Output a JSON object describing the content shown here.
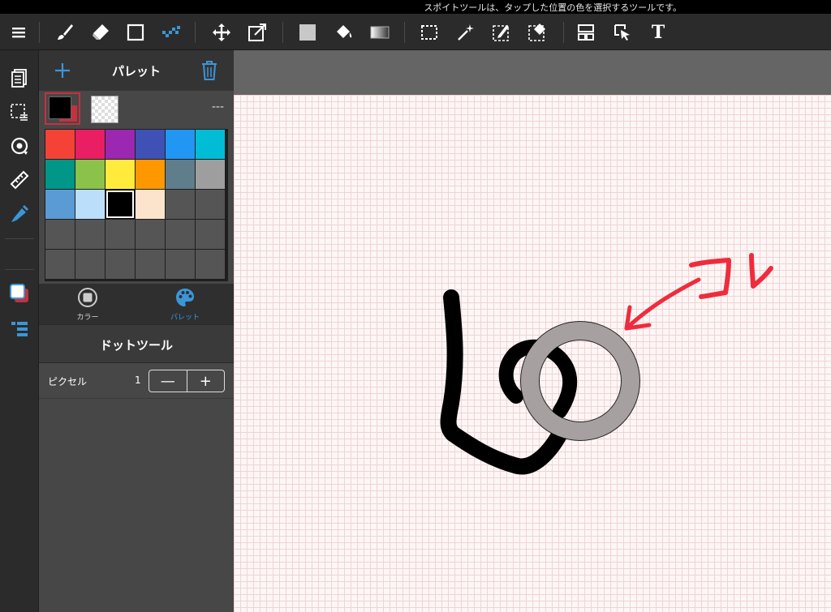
{
  "status": {
    "tooltip": "スポイトツールは、タップした位置の色を選択するツールです。"
  },
  "toolbar": {
    "tools": [
      "menu-icon",
      "brush-icon",
      "eraser-icon",
      "rectangle-icon",
      "dot-tool-icon",
      "move-icon",
      "transform-icon",
      "fill-color-icon",
      "bucket-icon",
      "gradient-icon",
      "select-rect-icon",
      "magic-wand-icon",
      "select-pen-icon",
      "select-eraser-icon",
      "layout-icon",
      "operation-icon",
      "text-icon"
    ],
    "text_tool_label": "T"
  },
  "rail": {
    "items": [
      "layers-icon",
      "selection-layer-icon",
      "rotate-icon",
      "ruler-icon",
      "material-icon",
      "color-icon",
      "layer-list-icon"
    ]
  },
  "palette": {
    "title": "パレット",
    "current_dashes": "---",
    "colors": [
      "#f44336",
      "#e91e63",
      "#9c27b0",
      "#3f51b5",
      "#2196f3",
      "#00bcd4",
      "#009688",
      "#8bc34a",
      "#ffeb3b",
      "#ff9800",
      "#607d8b",
      "#9e9e9e",
      "#5b9bd5",
      "#bbdefb",
      "#000000",
      "#fbe3cc",
      "#555555",
      "#555555",
      "#555555",
      "#555555",
      "#555555",
      "#555555",
      "#555555",
      "#555555",
      "#555555",
      "#555555",
      "#555555",
      "#555555",
      "#555555",
      "#555555"
    ],
    "selected_index": 14
  },
  "tabs": {
    "color": "カラー",
    "palette": "パレット"
  },
  "tool": {
    "title": "ドットツール",
    "pixel_label": "ピクセル",
    "pixel_value": "1",
    "minus": "—",
    "plus": "+"
  },
  "annotation": {
    "text": "コレ"
  },
  "colors": {
    "accent": "#3b96d8",
    "selected_red": "#c4313f",
    "annotation": "#ef2c3c"
  }
}
